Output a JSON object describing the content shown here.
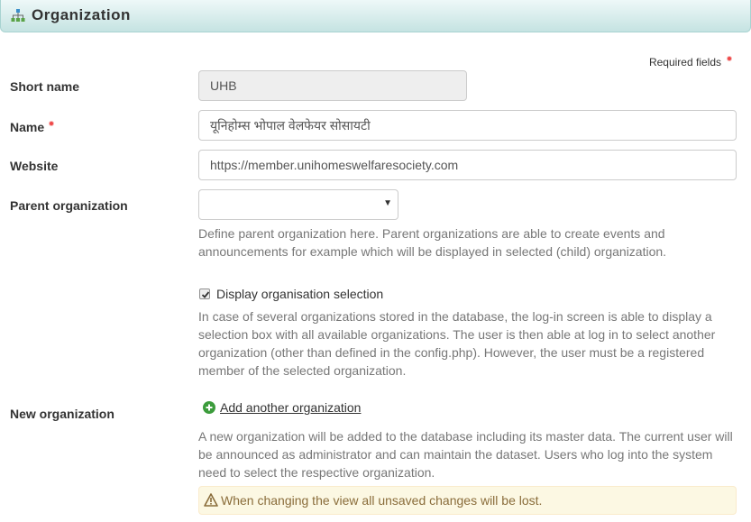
{
  "header": {
    "title": "Organization",
    "icon": "organization-tree-icon",
    "accent": "#c5e3e2"
  },
  "form": {
    "required_note": "Required fields",
    "short_name": {
      "label": "Short name",
      "value": "UHB"
    },
    "name": {
      "label": "Name",
      "value": "यूनिहोम्स भोपाल वेलफेयर सोसायटी"
    },
    "website": {
      "label": "Website",
      "value": "https://member.unihomeswelfaresociety.com"
    },
    "parent": {
      "label": "Parent organization",
      "selected": "",
      "help": "Define parent organization here. Parent organizations are able to create events and announcements for example which will be displayed in selected (child) organization."
    },
    "display_selection": {
      "label": "Display organisation selection",
      "checked": true,
      "help": "In case of several organizations stored in the database, the log-in screen is able to display a selection box with all available organizations. The user is then able at log in to select another organization (other than defined in the config.php). However, the user must be a registered member of the selected organization."
    },
    "new_org": {
      "label": "New organization",
      "link": "Add another organization",
      "help": "A new organization will be added to the database including its master data. The current user will be announced as administrator and can maintain the dataset. Users who log into the system need to select the respective organization.",
      "warning": "When changing the view all unsaved changes will be lost."
    }
  },
  "colors": {
    "required": "#f04848",
    "add_icon": "#3c9c3c",
    "warning_text": "#8a6d3b",
    "warning_bg": "#fcf8e3"
  }
}
